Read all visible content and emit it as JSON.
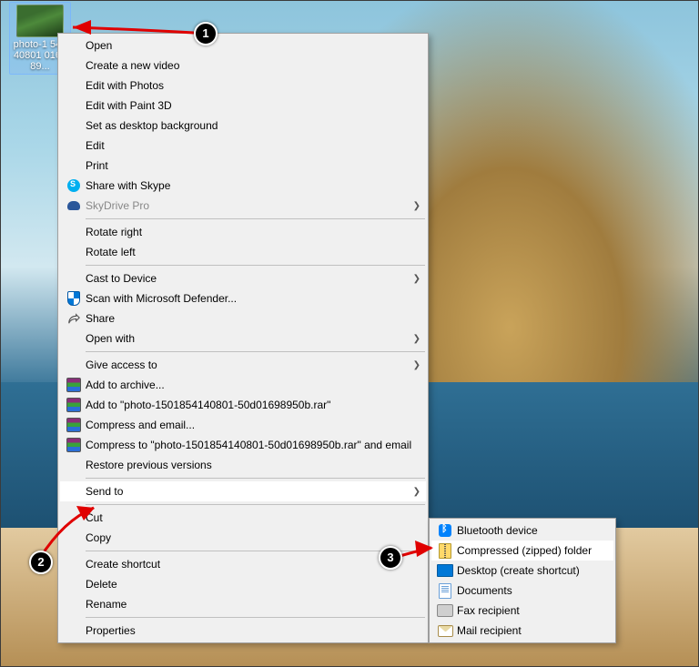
{
  "desktop_icon": {
    "filename": "photo-1\n54140801\n016989..."
  },
  "context_menu": {
    "items": [
      {
        "label": "Open",
        "icon": null
      },
      {
        "label": "Create a new video",
        "icon": null
      },
      {
        "label": "Edit with Photos",
        "icon": null
      },
      {
        "label": "Edit with Paint 3D",
        "icon": null
      },
      {
        "label": "Set as desktop background",
        "icon": null
      },
      {
        "label": "Edit",
        "icon": null
      },
      {
        "label": "Print",
        "icon": null
      },
      {
        "label": "Share with Skype",
        "icon": "skype"
      },
      {
        "label": "SkyDrive Pro",
        "icon": "cloud",
        "disabled": true,
        "submenu": true
      },
      {
        "sep": true
      },
      {
        "label": "Rotate right",
        "icon": null
      },
      {
        "label": "Rotate left",
        "icon": null
      },
      {
        "sep": true
      },
      {
        "label": "Cast to Device",
        "icon": null,
        "submenu": true
      },
      {
        "label": "Scan with Microsoft Defender...",
        "icon": "shield"
      },
      {
        "label": "Share",
        "icon": "share"
      },
      {
        "label": "Open with",
        "icon": null,
        "submenu": true
      },
      {
        "sep": true
      },
      {
        "label": "Give access to",
        "icon": null,
        "submenu": true
      },
      {
        "label": "Add to archive...",
        "icon": "rar"
      },
      {
        "label": "Add to \"photo-1501854140801-50d01698950b.rar\"",
        "icon": "rar"
      },
      {
        "label": "Compress and email...",
        "icon": "rar"
      },
      {
        "label": "Compress to \"photo-1501854140801-50d01698950b.rar\" and email",
        "icon": "rar"
      },
      {
        "label": "Restore previous versions",
        "icon": null
      },
      {
        "sep": true
      },
      {
        "label": "Send to",
        "icon": null,
        "submenu": true,
        "highlight": true
      },
      {
        "sep": true
      },
      {
        "label": "Cut",
        "icon": null
      },
      {
        "label": "Copy",
        "icon": null
      },
      {
        "sep": true
      },
      {
        "label": "Create shortcut",
        "icon": null
      },
      {
        "label": "Delete",
        "icon": null
      },
      {
        "label": "Rename",
        "icon": null
      },
      {
        "sep": true
      },
      {
        "label": "Properties",
        "icon": null
      }
    ]
  },
  "sendto_menu": {
    "items": [
      {
        "label": "Bluetooth device",
        "icon": "bt"
      },
      {
        "label": "Compressed (zipped) folder",
        "icon": "zip",
        "highlight": true
      },
      {
        "label": "Desktop (create shortcut)",
        "icon": "desktop"
      },
      {
        "label": "Documents",
        "icon": "doc"
      },
      {
        "label": "Fax recipient",
        "icon": "fax"
      },
      {
        "label": "Mail recipient",
        "icon": "mail"
      }
    ]
  },
  "callouts": {
    "n1": "1",
    "n2": "2",
    "n3": "3"
  }
}
